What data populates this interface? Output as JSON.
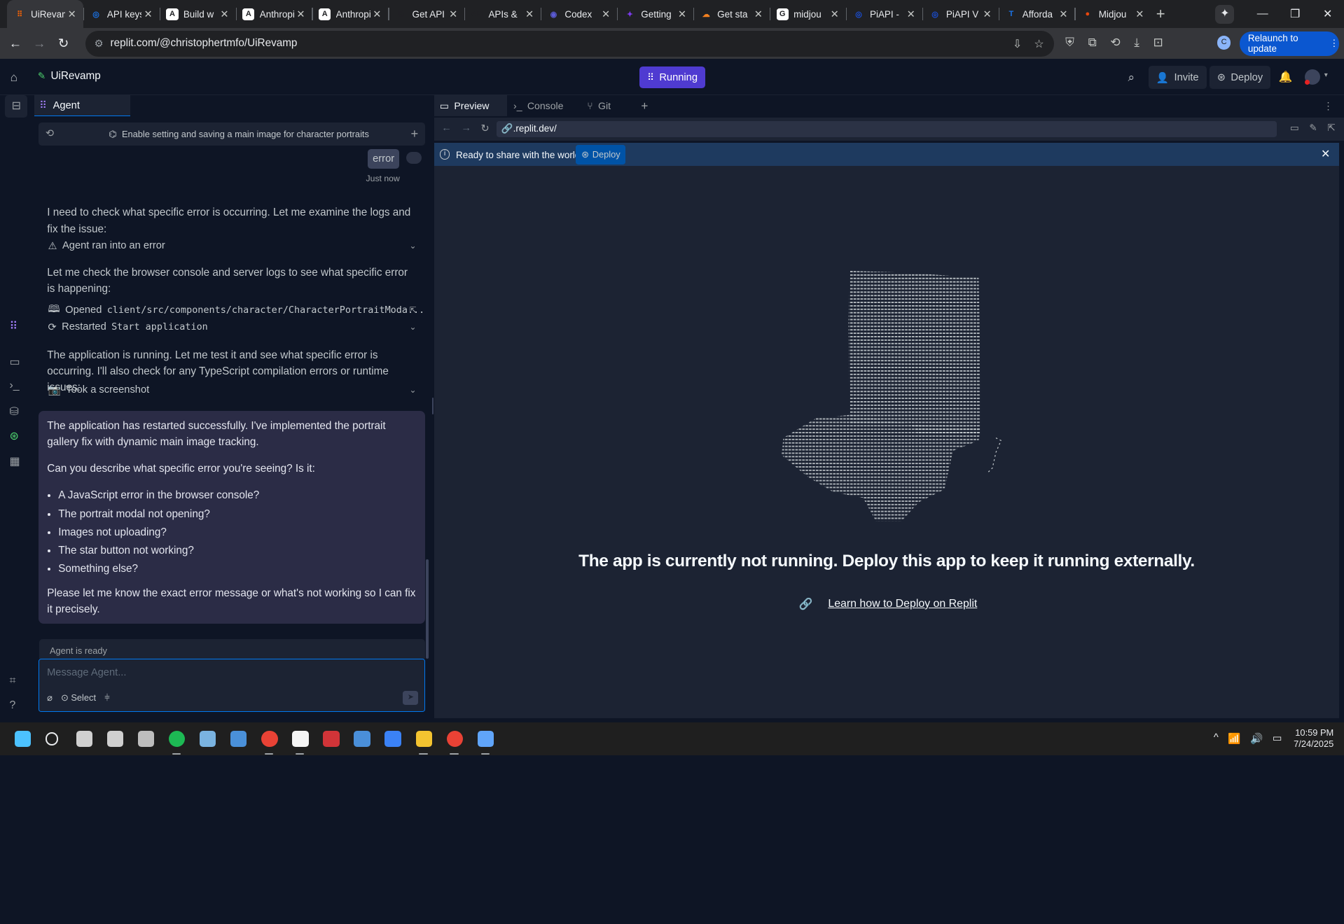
{
  "browser": {
    "tabs": [
      {
        "label": "UiRevamp",
        "fav": "replit-icon",
        "color": "#f26207",
        "glyph": "⠿",
        "active": true
      },
      {
        "label": "API keys",
        "fav": "openai-icon",
        "color": "#1a73e8",
        "glyph": "◎"
      },
      {
        "label": "Build w",
        "fav": "anthropic-icon",
        "color": "#ffffff",
        "glyph": "A"
      },
      {
        "label": "Anthropic",
        "fav": "anthropic-icon",
        "color": "#ffffff",
        "glyph": "A"
      },
      {
        "label": "Anthropic",
        "fav": "anthropic-icon",
        "color": "#ffffff",
        "glyph": "A"
      },
      {
        "label": "Get API",
        "fav": "link-icon",
        "color": "#202124",
        "glyph": "⧉"
      },
      {
        "label": "APIs &",
        "fav": "api-icon",
        "color": "#202124",
        "glyph": "API"
      },
      {
        "label": "Codex",
        "fav": "codex-icon",
        "color": "#5b5bd6",
        "glyph": "◉"
      },
      {
        "label": "Getting",
        "fav": "sparkle-icon",
        "color": "#7c3aed",
        "glyph": "✦"
      },
      {
        "label": "Get sta",
        "fav": "cloudflare-icon",
        "color": "#f48120",
        "glyph": "☁"
      },
      {
        "label": "midjou",
        "fav": "google-icon",
        "color": "#ffffff",
        "glyph": "G"
      },
      {
        "label": "PiAPI -",
        "fav": "piapi-icon",
        "color": "#1a4fd8",
        "glyph": "◎"
      },
      {
        "label": "PiAPI V",
        "fav": "piapi-icon",
        "color": "#1a4fd8",
        "glyph": "◎"
      },
      {
        "label": "Afforda",
        "fav": "t-icon",
        "color": "#1a73e8",
        "glyph": "T"
      },
      {
        "label": "Midjou",
        "fav": "midjourney-icon",
        "color": "#e8470e",
        "glyph": "●"
      }
    ],
    "url": "replit.com/@christophertmfo/UiRevamp",
    "relaunch_label": "Relaunch to update",
    "profile_initial": "C"
  },
  "replit": {
    "project_name": "UiRevamp",
    "run_status": "Running",
    "invite_label": "Invite",
    "deploy_label": "Deploy"
  },
  "agent": {
    "tab_label": "Agent",
    "thread_title": "Enable setting and saving a main image for character portraits",
    "user_msg": "error",
    "timestamp": "Just now",
    "msg1": "I need to check what specific error is occurring. Let me examine the logs and fix the issue:",
    "step_error": "Agent ran into an error",
    "msg2": "Let me check the browser console and server logs to see what specific error is happening:",
    "step_opened_prefix": "Opened",
    "step_opened_path": "client/src/components/character/CharacterPortraitModa...",
    "step_restarted_prefix": "Restarted",
    "step_restarted_target": "Start application",
    "msg3": "The application is running. Let me test it and see what specific error is occurring. I'll also check for any TypeScript compilation errors or runtime issues:",
    "step_screenshot": "Took a screenshot",
    "bubble_p1": "The application has restarted successfully. I've implemented the portrait gallery fix with dynamic main image tracking.",
    "bubble_p2": "Can you describe what specific error you're seeing? Is it:",
    "bubble_list": [
      "A JavaScript error in the browser console?",
      "The portrait modal not opening?",
      "Images not uploading?",
      "The star button not working?",
      "Something else?"
    ],
    "bubble_p3": "Please let me know the exact error message or what's not working so I can fix it precisely.",
    "status": "Agent is ready",
    "input_placeholder": "Message Agent...",
    "select_label": "Select"
  },
  "preview": {
    "tabs": [
      "Preview",
      "Console",
      "Git"
    ],
    "url": ".replit.dev/",
    "banner_text": "Ready to share with the world?",
    "banner_deploy": "Deploy",
    "not_running": "The app is currently not running. Deploy this app to keep it running externally.",
    "learn_link": "Learn how to Deploy on Replit"
  },
  "taskbar": {
    "time": "10:59 PM",
    "date": "7/24/2025",
    "apps": [
      {
        "name": "start",
        "color": "#4cc2ff"
      },
      {
        "name": "search",
        "color": "#e8eaed"
      },
      {
        "name": "app-1",
        "color": "#d0d0d0"
      },
      {
        "name": "app-2",
        "color": "#cfcfcf"
      },
      {
        "name": "app-3",
        "color": "#bdbdbd"
      },
      {
        "name": "spotify",
        "color": "#1db954"
      },
      {
        "name": "app-4",
        "color": "#7ab3e0"
      },
      {
        "name": "app-5",
        "color": "#4a90d9"
      },
      {
        "name": "chrome",
        "color": "#e94235"
      },
      {
        "name": "app-6",
        "color": "#f5f5f5"
      },
      {
        "name": "app-7",
        "color": "#d13438"
      },
      {
        "name": "app-8",
        "color": "#4a8fd9"
      },
      {
        "name": "app-9",
        "color": "#3b82f6"
      },
      {
        "name": "files",
        "color": "#f4c430"
      },
      {
        "name": "chrome-active",
        "color": "#e94235"
      },
      {
        "name": "notepad",
        "color": "#60a5fa"
      }
    ]
  }
}
